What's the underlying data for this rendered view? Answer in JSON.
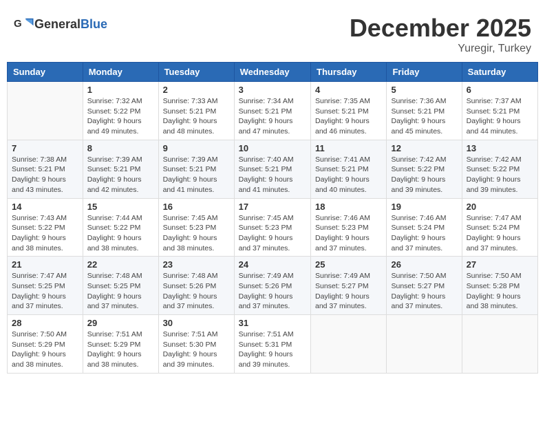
{
  "header": {
    "logo_general": "General",
    "logo_blue": "Blue",
    "month": "December 2025",
    "location": "Yuregir, Turkey"
  },
  "weekdays": [
    "Sunday",
    "Monday",
    "Tuesday",
    "Wednesday",
    "Thursday",
    "Friday",
    "Saturday"
  ],
  "weeks": [
    [
      {
        "day": "",
        "info": ""
      },
      {
        "day": "1",
        "info": "Sunrise: 7:32 AM\nSunset: 5:22 PM\nDaylight: 9 hours\nand 49 minutes."
      },
      {
        "day": "2",
        "info": "Sunrise: 7:33 AM\nSunset: 5:21 PM\nDaylight: 9 hours\nand 48 minutes."
      },
      {
        "day": "3",
        "info": "Sunrise: 7:34 AM\nSunset: 5:21 PM\nDaylight: 9 hours\nand 47 minutes."
      },
      {
        "day": "4",
        "info": "Sunrise: 7:35 AM\nSunset: 5:21 PM\nDaylight: 9 hours\nand 46 minutes."
      },
      {
        "day": "5",
        "info": "Sunrise: 7:36 AM\nSunset: 5:21 PM\nDaylight: 9 hours\nand 45 minutes."
      },
      {
        "day": "6",
        "info": "Sunrise: 7:37 AM\nSunset: 5:21 PM\nDaylight: 9 hours\nand 44 minutes."
      }
    ],
    [
      {
        "day": "7",
        "info": "Sunrise: 7:38 AM\nSunset: 5:21 PM\nDaylight: 9 hours\nand 43 minutes."
      },
      {
        "day": "8",
        "info": "Sunrise: 7:39 AM\nSunset: 5:21 PM\nDaylight: 9 hours\nand 42 minutes."
      },
      {
        "day": "9",
        "info": "Sunrise: 7:39 AM\nSunset: 5:21 PM\nDaylight: 9 hours\nand 41 minutes."
      },
      {
        "day": "10",
        "info": "Sunrise: 7:40 AM\nSunset: 5:21 PM\nDaylight: 9 hours\nand 41 minutes."
      },
      {
        "day": "11",
        "info": "Sunrise: 7:41 AM\nSunset: 5:21 PM\nDaylight: 9 hours\nand 40 minutes."
      },
      {
        "day": "12",
        "info": "Sunrise: 7:42 AM\nSunset: 5:22 PM\nDaylight: 9 hours\nand 39 minutes."
      },
      {
        "day": "13",
        "info": "Sunrise: 7:42 AM\nSunset: 5:22 PM\nDaylight: 9 hours\nand 39 minutes."
      }
    ],
    [
      {
        "day": "14",
        "info": "Sunrise: 7:43 AM\nSunset: 5:22 PM\nDaylight: 9 hours\nand 38 minutes."
      },
      {
        "day": "15",
        "info": "Sunrise: 7:44 AM\nSunset: 5:22 PM\nDaylight: 9 hours\nand 38 minutes."
      },
      {
        "day": "16",
        "info": "Sunrise: 7:45 AM\nSunset: 5:23 PM\nDaylight: 9 hours\nand 38 minutes."
      },
      {
        "day": "17",
        "info": "Sunrise: 7:45 AM\nSunset: 5:23 PM\nDaylight: 9 hours\nand 37 minutes."
      },
      {
        "day": "18",
        "info": "Sunrise: 7:46 AM\nSunset: 5:23 PM\nDaylight: 9 hours\nand 37 minutes."
      },
      {
        "day": "19",
        "info": "Sunrise: 7:46 AM\nSunset: 5:24 PM\nDaylight: 9 hours\nand 37 minutes."
      },
      {
        "day": "20",
        "info": "Sunrise: 7:47 AM\nSunset: 5:24 PM\nDaylight: 9 hours\nand 37 minutes."
      }
    ],
    [
      {
        "day": "21",
        "info": "Sunrise: 7:47 AM\nSunset: 5:25 PM\nDaylight: 9 hours\nand 37 minutes."
      },
      {
        "day": "22",
        "info": "Sunrise: 7:48 AM\nSunset: 5:25 PM\nDaylight: 9 hours\nand 37 minutes."
      },
      {
        "day": "23",
        "info": "Sunrise: 7:48 AM\nSunset: 5:26 PM\nDaylight: 9 hours\nand 37 minutes."
      },
      {
        "day": "24",
        "info": "Sunrise: 7:49 AM\nSunset: 5:26 PM\nDaylight: 9 hours\nand 37 minutes."
      },
      {
        "day": "25",
        "info": "Sunrise: 7:49 AM\nSunset: 5:27 PM\nDaylight: 9 hours\nand 37 minutes."
      },
      {
        "day": "26",
        "info": "Sunrise: 7:50 AM\nSunset: 5:27 PM\nDaylight: 9 hours\nand 37 minutes."
      },
      {
        "day": "27",
        "info": "Sunrise: 7:50 AM\nSunset: 5:28 PM\nDaylight: 9 hours\nand 38 minutes."
      }
    ],
    [
      {
        "day": "28",
        "info": "Sunrise: 7:50 AM\nSunset: 5:29 PM\nDaylight: 9 hours\nand 38 minutes."
      },
      {
        "day": "29",
        "info": "Sunrise: 7:51 AM\nSunset: 5:29 PM\nDaylight: 9 hours\nand 38 minutes."
      },
      {
        "day": "30",
        "info": "Sunrise: 7:51 AM\nSunset: 5:30 PM\nDaylight: 9 hours\nand 39 minutes."
      },
      {
        "day": "31",
        "info": "Sunrise: 7:51 AM\nSunset: 5:31 PM\nDaylight: 9 hours\nand 39 minutes."
      },
      {
        "day": "",
        "info": ""
      },
      {
        "day": "",
        "info": ""
      },
      {
        "day": "",
        "info": ""
      }
    ]
  ]
}
